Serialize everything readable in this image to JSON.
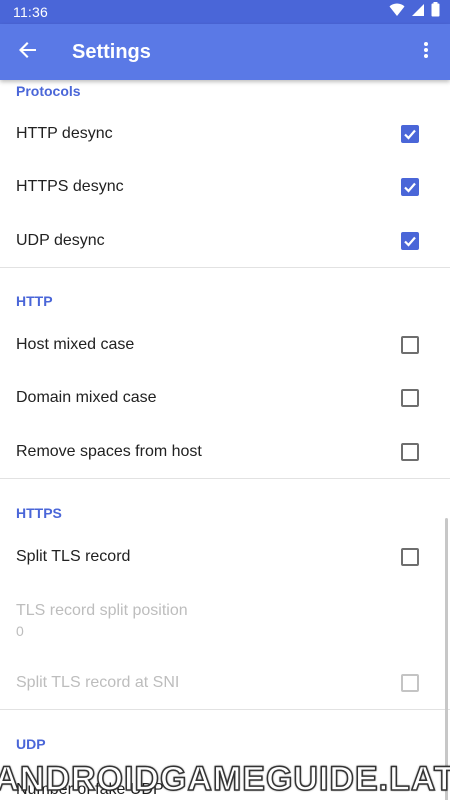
{
  "status_bar": {
    "time": "11:36",
    "icons": [
      "wifi-icon",
      "signal-icon",
      "battery-icon"
    ]
  },
  "app_bar": {
    "title": "Settings",
    "back_icon": "arrow-back-icon",
    "menu_icon": "more-vert-icon"
  },
  "colors": {
    "app_bar": "#5a79e6",
    "status_bar": "#4a66d8",
    "accent": "#4a66d8",
    "text": "#212121",
    "disabled_text": "#bdbdbd"
  },
  "sections": {
    "protocols": {
      "title": "Protocols",
      "items": [
        {
          "label": "HTTP desync",
          "checked": true
        },
        {
          "label": "HTTPS desync",
          "checked": true
        },
        {
          "label": "UDP desync",
          "checked": true
        }
      ]
    },
    "http": {
      "title": "HTTP",
      "items": [
        {
          "label": "Host mixed case",
          "checked": false
        },
        {
          "label": "Domain mixed case",
          "checked": false
        },
        {
          "label": "Remove spaces from host",
          "checked": false
        }
      ]
    },
    "https": {
      "title": "HTTPS",
      "items": [
        {
          "label": "Split TLS record",
          "checked": false
        },
        {
          "label": "TLS record split position",
          "summary": "0",
          "enabled": false
        },
        {
          "label": "Split TLS record at SNI",
          "checked": false,
          "enabled": false
        }
      ]
    },
    "udp": {
      "title": "UDP",
      "items": [
        {
          "label": "Number of fake UDP"
        }
      ]
    }
  },
  "watermark": "ANDROIDGAMEGUIDE.LAT"
}
